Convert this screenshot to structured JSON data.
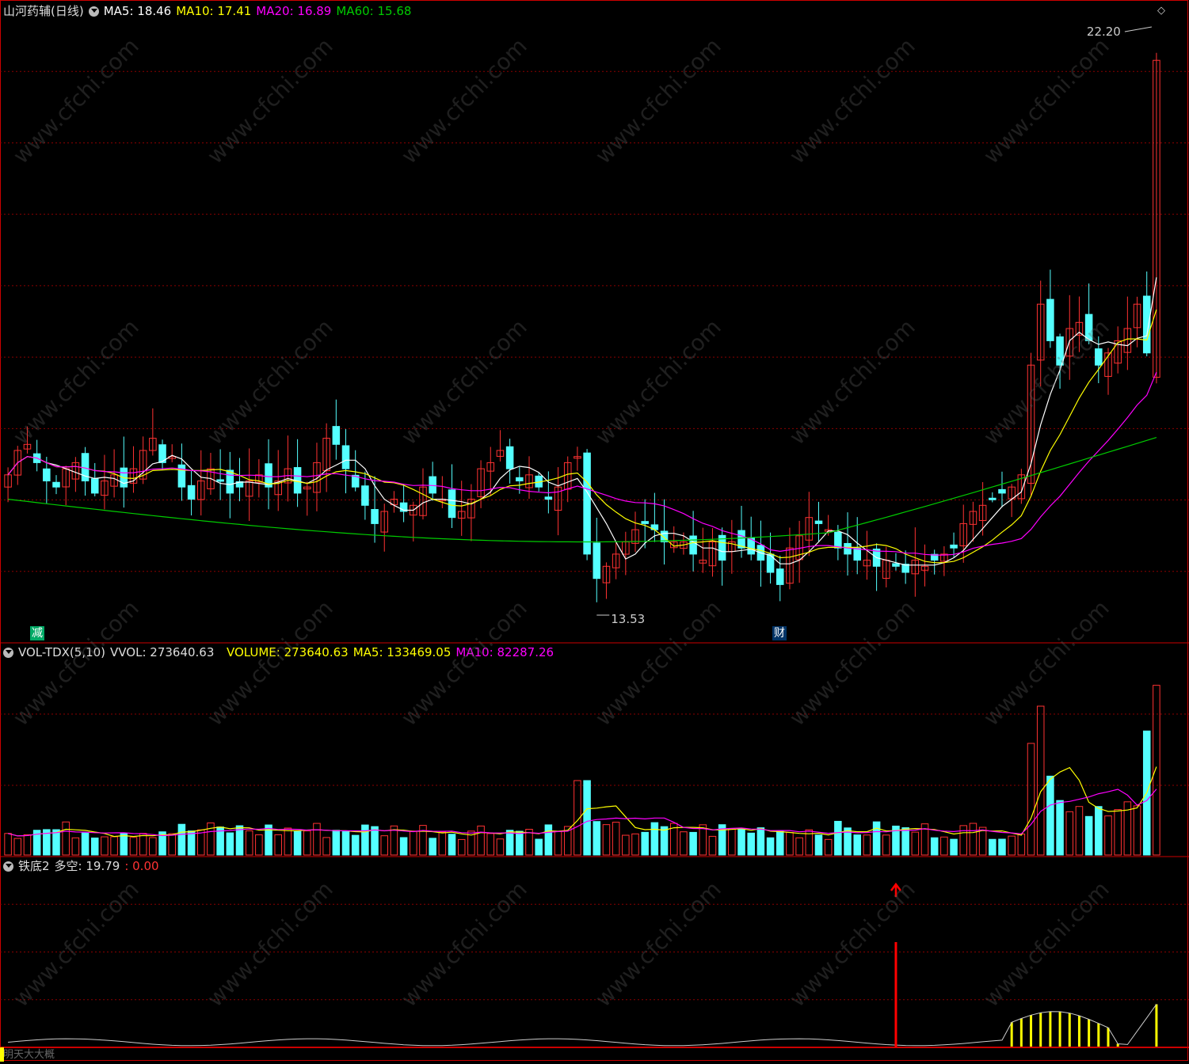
{
  "title_bar": {
    "stock_name": "山河药辅(日线)",
    "ma5": "MA5: 18.46",
    "ma10": "MA10: 17.41",
    "ma20": "MA20: 16.89",
    "ma60": "MA60: 15.68"
  },
  "vol_panel": {
    "indicator": "VOL-TDX(5,10)",
    "vvol": "VVOL: 273640.63",
    "volume": "VOLUME: 273640.63",
    "ma5": "MA5: 133469.05",
    "ma10": "MA10: 82287.26"
  },
  "osc_panel": {
    "indicator": "铁底2",
    "duokong": "多空: 19.79",
    "signal": ": 0.00"
  },
  "bottom_label": "明天大大概",
  "badges": {
    "jian": "减",
    "cai": "财"
  },
  "watermark": "www.cfchi.com",
  "colors": {
    "up": "#ff3232",
    "down": "#54ffff",
    "ma5": "#ffffff",
    "ma10": "#ffff00",
    "ma20": "#ff00ff",
    "ma60": "#00cc00",
    "grid": "#8b0000",
    "signal_bar": "#ffff00",
    "arrow": "#ff0000"
  },
  "chart_data": {
    "type": "candlestick",
    "bars": 120,
    "price_ylim": [
      12.8,
      22.8
    ],
    "annotations": {
      "high": "22.20",
      "low": "13.53"
    },
    "close": [
      15.4,
      15.8,
      15.9,
      15.6,
      15.3,
      15.2,
      15.5,
      15.6,
      15.3,
      15.1,
      15.3,
      15.4,
      15.2,
      15.5,
      15.8,
      16.0,
      15.6,
      15.7,
      15.2,
      15.0,
      15.3,
      15.5,
      15.3,
      15.1,
      15.2,
      15.3,
      15.4,
      15.2,
      15.3,
      15.5,
      15.1,
      15.2,
      15.6,
      16.0,
      15.9,
      15.5,
      15.2,
      14.9,
      14.6,
      14.8,
      15.0,
      14.8,
      14.9,
      15.2,
      15.1,
      15.0,
      14.7,
      14.8,
      15.0,
      15.5,
      15.6,
      15.8,
      15.5,
      15.3,
      15.4,
      15.2,
      15.0,
      15.2,
      15.6,
      15.7,
      14.1,
      13.7,
      13.9,
      14.1,
      14.3,
      14.5,
      14.6,
      14.5,
      14.3,
      14.3,
      14.3,
      14.1,
      14.0,
      14.3,
      14.0,
      14.3,
      14.2,
      14.1,
      14.0,
      13.8,
      13.6,
      14.2,
      14.4,
      14.7,
      14.6,
      14.5,
      14.2,
      14.1,
      14.0,
      14.0,
      13.9,
      14.0,
      13.9,
      13.8,
      14.0,
      13.9,
      14.0,
      14.1,
      14.2,
      14.6,
      14.8,
      14.9,
      15.0,
      15.1,
      15.2,
      15.4,
      17.2,
      18.2,
      17.6,
      17.2,
      17.8,
      17.9,
      17.6,
      17.2,
      17.4,
      17.6,
      17.8,
      18.2,
      17.4,
      22.2
    ],
    "volume_ylim": [
      0,
      300000
    ],
    "volume_range": [
      25000,
      273640
    ]
  }
}
